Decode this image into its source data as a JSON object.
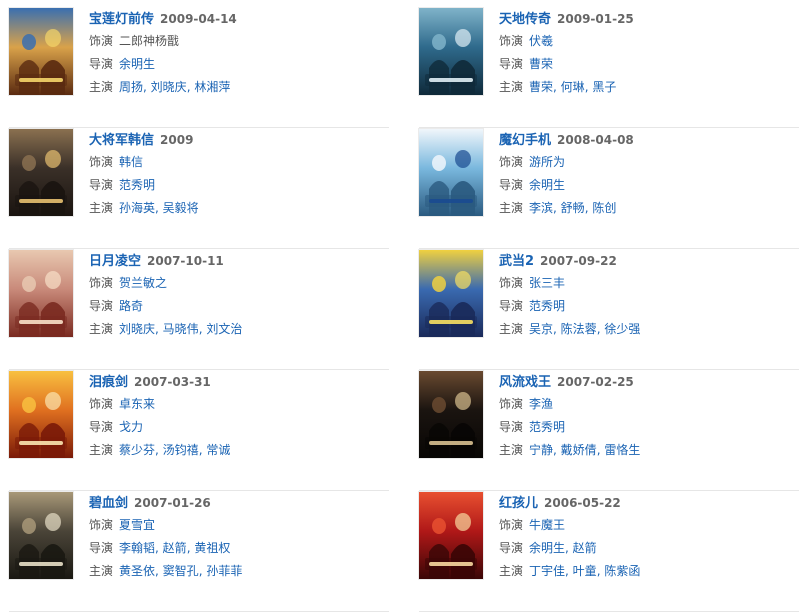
{
  "labels": {
    "role": "饰演",
    "director": "导演",
    "cast": "主演"
  },
  "items": [
    {
      "title": "宝莲灯前传",
      "date": "2009-04-14",
      "role": "二郎神杨戬",
      "role_linked": false,
      "directors": [
        "余明生"
      ],
      "cast": [
        "周扬",
        "刘晓庆",
        "林湘萍"
      ],
      "poster": {
        "bg": "#d9a24a",
        "accent": "#3a6fb0",
        "dark": "#5a2a10",
        "text": "#f5d56a"
      }
    },
    {
      "title": "天地传奇",
      "date": "2009-01-25",
      "role": "伏羲",
      "role_linked": true,
      "directors": [
        "曹荣"
      ],
      "cast": [
        "曹荣",
        "何琳",
        "黑子"
      ],
      "poster": {
        "bg": "#2f6a8c",
        "accent": "#7fb3c9",
        "dark": "#0f2a3a",
        "text": "#e0eef5"
      }
    },
    {
      "title": "大将军韩信",
      "date": "2009",
      "role": "韩信",
      "role_linked": true,
      "directors": [
        "范秀明"
      ],
      "cast": [
        "孙海英",
        "吴毅将"
      ],
      "poster": {
        "bg": "#3a3028",
        "accent": "#8a7050",
        "dark": "#1a1410",
        "text": "#e8c070"
      }
    },
    {
      "title": "魔幻手机",
      "date": "2008-04-08",
      "role": "游所为",
      "role_linked": true,
      "directors": [
        "余明生"
      ],
      "cast": [
        "李滨",
        "舒畅",
        "陈创"
      ],
      "poster": {
        "bg": "#7ab8de",
        "accent": "#f0f6fb",
        "dark": "#2a5a80",
        "text": "#1a4a90"
      }
    },
    {
      "title": "日月凌空",
      "date": "2007-10-11",
      "role": "贺兰敏之",
      "role_linked": true,
      "directors": [
        "路奇"
      ],
      "cast": [
        "刘晓庆",
        "马晓伟",
        "刘文治"
      ],
      "poster": {
        "bg": "#c98a7a",
        "accent": "#e8c8b0",
        "dark": "#7a2a20",
        "text": "#f8e0c8"
      }
    },
    {
      "title": "武当2",
      "date": "2007-09-22",
      "role": "张三丰",
      "role_linked": true,
      "directors": [
        "范秀明"
      ],
      "cast": [
        "吴京",
        "陈法蓉",
        "徐少强"
      ],
      "poster": {
        "bg": "#3a6ab0",
        "accent": "#f0d040",
        "dark": "#1a2a5a",
        "text": "#f8e060"
      }
    },
    {
      "title": "泪痕剑",
      "date": "2007-03-31",
      "role": "卓东来",
      "role_linked": true,
      "directors": [
        "戈力"
      ],
      "cast": [
        "蔡少芬",
        "汤钧禧",
        "常诚"
      ],
      "poster": {
        "bg": "#e07020",
        "accent": "#f8c040",
        "dark": "#7a1a08",
        "text": "#fbe6b0"
      }
    },
    {
      "title": "风流戏王",
      "date": "2007-02-25",
      "role": "李渔",
      "role_linked": true,
      "directors": [
        "范秀明"
      ],
      "cast": [
        "宁静",
        "戴娇倩",
        "雷恪生"
      ],
      "poster": {
        "bg": "#1a1410",
        "accent": "#6a4a30",
        "dark": "#080604",
        "text": "#d8c090"
      }
    },
    {
      "title": "碧血剑",
      "date": "2007-01-26",
      "role": "夏雪宜",
      "role_linked": true,
      "directors": [
        "李翰韬",
        "赵箭",
        "黄祖权"
      ],
      "cast": [
        "黄圣依",
        "窦智孔",
        "孙菲菲"
      ],
      "poster": {
        "bg": "#4a4438",
        "accent": "#a89878",
        "dark": "#1a1812",
        "text": "#e8e0c8"
      }
    },
    {
      "title": "红孩儿",
      "date": "2006-05-22",
      "role": "牛魔王",
      "role_linked": true,
      "directors": [
        "余明生",
        "赵箭"
      ],
      "cast": [
        "丁宇佳",
        "叶童",
        "陈紫函"
      ],
      "poster": {
        "bg": "#b01818",
        "accent": "#e85030",
        "dark": "#3a0606",
        "text": "#f8d8a0"
      }
    }
  ]
}
